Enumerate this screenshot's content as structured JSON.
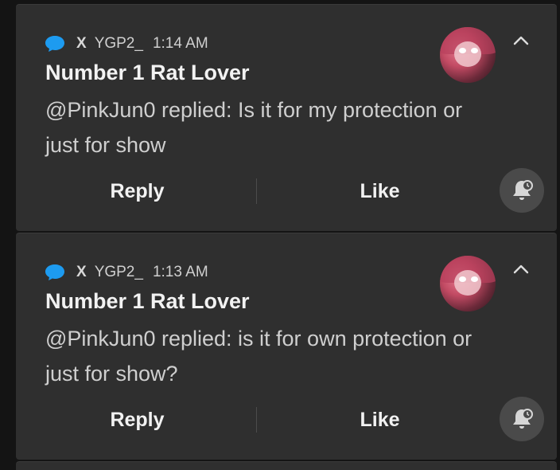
{
  "colors": {
    "background": "#141414",
    "card": "#2f2f2f",
    "accent": "#1d9bf0",
    "text_primary": "#f2f2f2",
    "text_secondary": "#cfcfcf"
  },
  "notifications": [
    {
      "app_icon": "chat-bubble-icon",
      "app_name": "X",
      "account": "YGP2_",
      "time": "1:14 AM",
      "title": "Number 1 Rat Lover",
      "body": "@PinkJun0 replied: Is it for my protection or just for show",
      "reply_label": "Reply",
      "like_label": "Like",
      "collapse_icon": "chevron-up-icon",
      "snooze_icon": "snooze-bell-icon"
    },
    {
      "app_icon": "chat-bubble-icon",
      "app_name": "X",
      "account": "YGP2_",
      "time": "1:13 AM",
      "title": "Number 1 Rat Lover",
      "body": "@PinkJun0 replied: is it for own protection or just for show?",
      "reply_label": "Reply",
      "like_label": "Like",
      "collapse_icon": "chevron-up-icon",
      "snooze_icon": "snooze-bell-icon"
    }
  ]
}
